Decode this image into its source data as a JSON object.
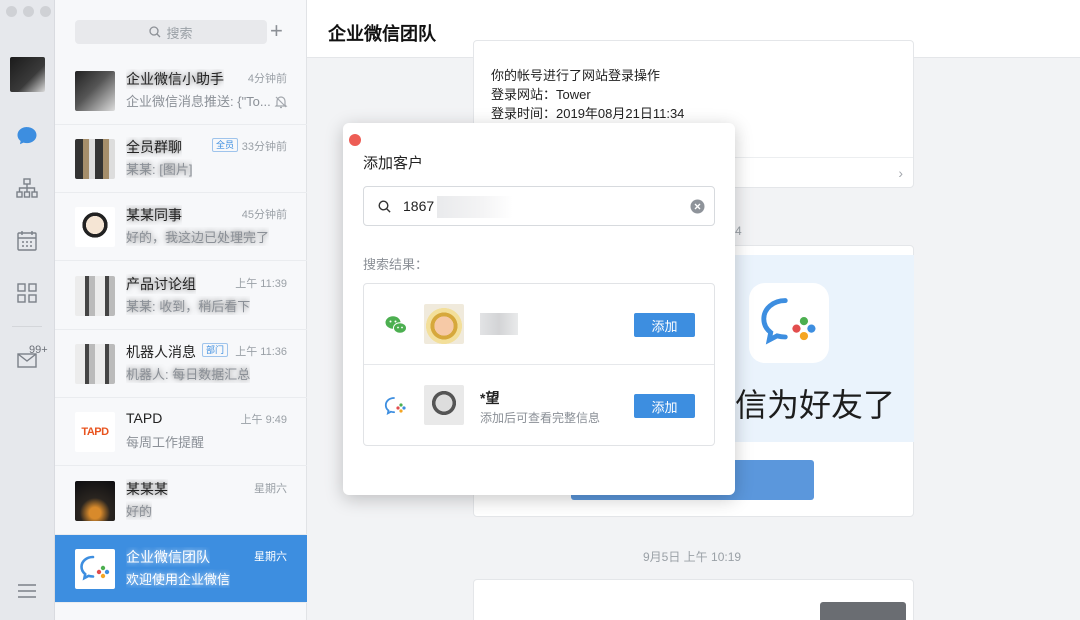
{
  "list": {
    "search_placeholder": "搜索",
    "plus": "+",
    "items": [
      {
        "name": "企业微信小助手",
        "time": "4分钟前",
        "msg": "企业微信消息推送: {\"To...",
        "name_blurred": true
      },
      {
        "name": "全员群聊",
        "tag": "全员",
        "time": "33分钟前",
        "msg": "某某: [图片]",
        "name_blurred": true,
        "msg_blurred": true
      },
      {
        "name": "某某同事",
        "time": "45分钟前",
        "msg": "好的，我这边已处理完了",
        "name_blurred": true,
        "msg_blurred": true
      },
      {
        "name": "产品讨论组",
        "time": "上午 11:39",
        "msg": "某某: 收到，稍后看下",
        "name_blurred": true,
        "msg_blurred": true
      },
      {
        "name": "机器人消息",
        "tag": "部门",
        "time": "上午 11:36",
        "msg": "机器人: 每日数据汇总",
        "msg_blurred": true
      },
      {
        "name": "TAPD",
        "time": "上午 9:49",
        "msg": "每周工作提醒"
      },
      {
        "name": "某某某",
        "time": "星期六",
        "msg": "好的",
        "name_blurred": true,
        "msg_blurred": true
      },
      {
        "name": "企业微信团队",
        "time": "星期六",
        "msg": "欢迎使用企业微信",
        "name_blurred": true,
        "msg_blurred": true
      }
    ]
  },
  "rail": {
    "badge": "99+"
  },
  "main": {
    "title": "企业微信团队",
    "login_card": {
      "line1": "你的帐号进行了网站登录操作",
      "line2": "登录网站：Tower",
      "line3": "登录时间：2019年08月21日11:34"
    },
    "banner_text": "信为好友了",
    "timestamp1": "4",
    "timestamp2": "9月5日 上午 10:19"
  },
  "dialog": {
    "title": "添加客户",
    "search_value": "1867",
    "results_label": "搜索结果：",
    "results": [
      {
        "source": "wechat-icon",
        "name": "",
        "sub": "",
        "button": "添加"
      },
      {
        "source": "wework-icon",
        "name": "*望",
        "sub": "添加后可查看完整信息",
        "button": "添加"
      }
    ]
  },
  "colors": {
    "accent": "#3d8ee0",
    "close": "#ed5d55",
    "wechat_green": "#4caf50"
  }
}
